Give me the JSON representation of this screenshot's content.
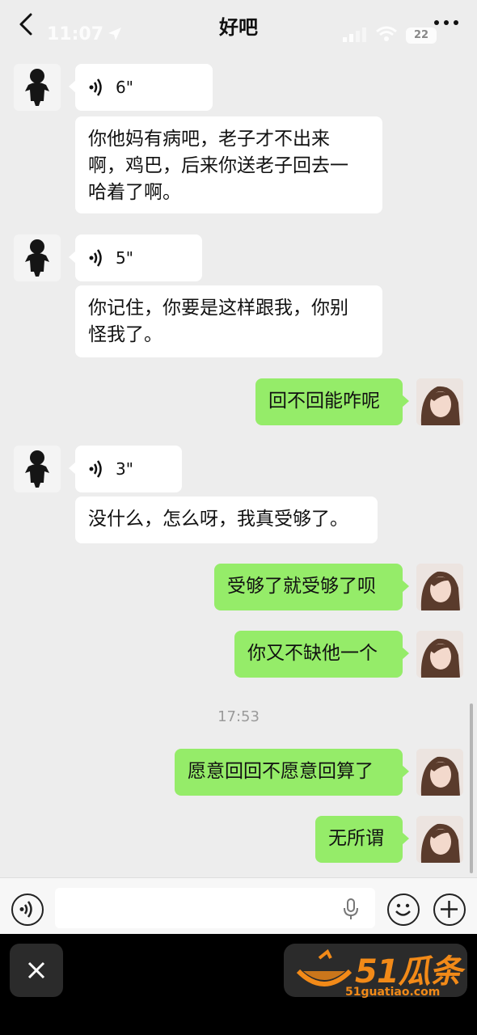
{
  "status_bar": {
    "time": "11:07",
    "battery": "22"
  },
  "header": {
    "title": "好吧"
  },
  "messages": [
    {
      "side": "left",
      "type": "voice",
      "duration": "6\""
    },
    {
      "side": "left",
      "type": "text",
      "text_lines": [
        "你他妈有病吧，老子才不出来",
        "啊，鸡巴，后来你送老子回去一",
        "哈着了啊。"
      ]
    },
    {
      "side": "left",
      "type": "voice",
      "duration": "5\""
    },
    {
      "side": "left",
      "type": "text",
      "text_lines": [
        "你记住，你要是这样跟我，你别",
        "怪我了。"
      ]
    },
    {
      "side": "right",
      "type": "text",
      "text": "回不回能咋呢"
    },
    {
      "side": "left",
      "type": "voice",
      "duration": "3\""
    },
    {
      "side": "left",
      "type": "text",
      "text": "没什么，怎么呀，我真受够了。"
    },
    {
      "side": "right",
      "type": "text",
      "text": "受够了就受够了呗"
    },
    {
      "side": "right",
      "type": "text",
      "text": "你又不缺他一个"
    },
    {
      "side": "right",
      "type": "text",
      "text": "愿意回回不愿意回算了"
    },
    {
      "side": "right",
      "type": "text",
      "text": "无所谓"
    }
  ],
  "timestamp": "17:53",
  "watermark": {
    "brand": "51瓜条",
    "url": "51guatiao.com"
  },
  "colors": {
    "outgoing_bubble": "#95ec69",
    "incoming_bubble": "#ffffff",
    "background": "#ededed",
    "watermark": "#f28a18"
  }
}
